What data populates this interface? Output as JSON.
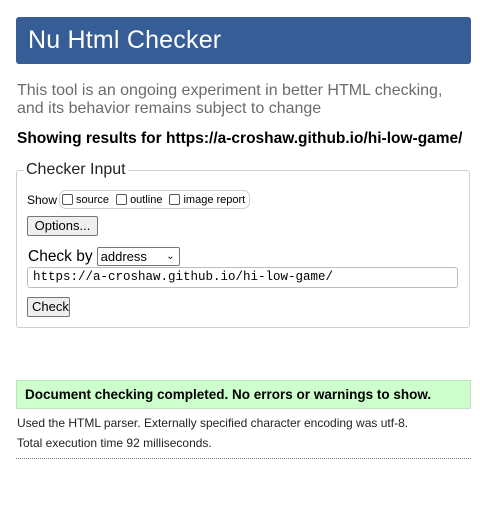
{
  "header": {
    "title": "Nu Html Checker"
  },
  "intro": {
    "text": "This tool is an ongoing experiment in better HTML checking, and its behavior remains subject to change"
  },
  "showing": {
    "text": "Showing results for https://a-croshaw.github.io/hi-low-game/"
  },
  "checker_input": {
    "legend": "Checker Input",
    "show_label": "Show",
    "show_options": [
      "source",
      "outline",
      "image report"
    ],
    "options_button": "Options...",
    "check_by_label": "Check by",
    "check_by_value": "address",
    "url_value": "https://a-croshaw.github.io/hi-low-game/",
    "check_button": "Check"
  },
  "results": {
    "success_message": "Document checking completed. No errors or warnings to show.",
    "parser_note": "Used the HTML parser. Externally specified character encoding was utf-8.",
    "execution_time": "Total execution time 92 milliseconds."
  },
  "colors": {
    "header_bg": "#365d95",
    "success_bg": "#ccffcc"
  }
}
